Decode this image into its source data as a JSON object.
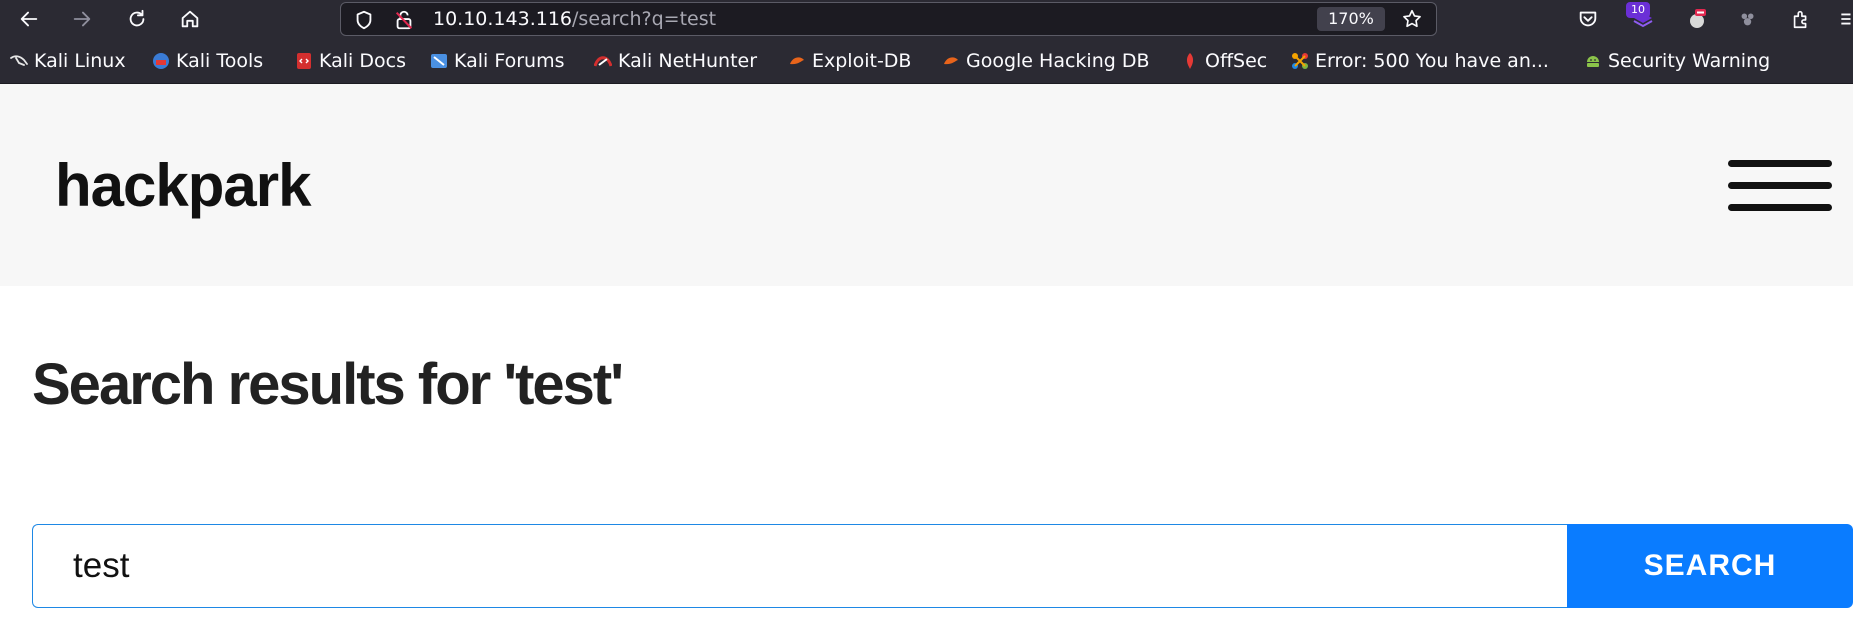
{
  "browser": {
    "url": {
      "host": "10.10.143.116",
      "path": "/search?q=test"
    },
    "zoom": "170%",
    "extension_badge": "10"
  },
  "bookmarks": [
    {
      "label": "Kali Linux",
      "icon": "kali-dragon-icon",
      "color": "#e6e6e6"
    },
    {
      "label": "Kali Tools",
      "icon": "kali-tools-icon",
      "color": "#3a7bd5"
    },
    {
      "label": "Kali Docs",
      "icon": "kali-docs-icon",
      "color": "#d32f2f"
    },
    {
      "label": "Kali Forums",
      "icon": "kali-forums-icon",
      "color": "#4a90e2"
    },
    {
      "label": "Kali NetHunter",
      "icon": "nethunter-icon",
      "color": "#d32f2f"
    },
    {
      "label": "Exploit-DB",
      "icon": "exploit-db-icon",
      "color": "#e8641b"
    },
    {
      "label": "Google Hacking DB",
      "icon": "ghdb-icon",
      "color": "#e8641b"
    },
    {
      "label": "OffSec",
      "icon": "offsec-icon",
      "color": "#e53935"
    },
    {
      "label": "Error: 500 You have an...",
      "icon": "joomla-icon",
      "color": "#f4a300"
    },
    {
      "label": "Security Warning",
      "icon": "android-icon",
      "color": "#8bc34a"
    }
  ],
  "site": {
    "brand": "hackpark",
    "menu_icon": "hamburger-menu-icon"
  },
  "search": {
    "heading": "Search results for 'test'",
    "query": "test",
    "button_label": "SEARCH"
  },
  "colors": {
    "browser_chrome": "#2b2a33",
    "header_bg": "#f7f7f7",
    "accent": "#0a7cff"
  }
}
